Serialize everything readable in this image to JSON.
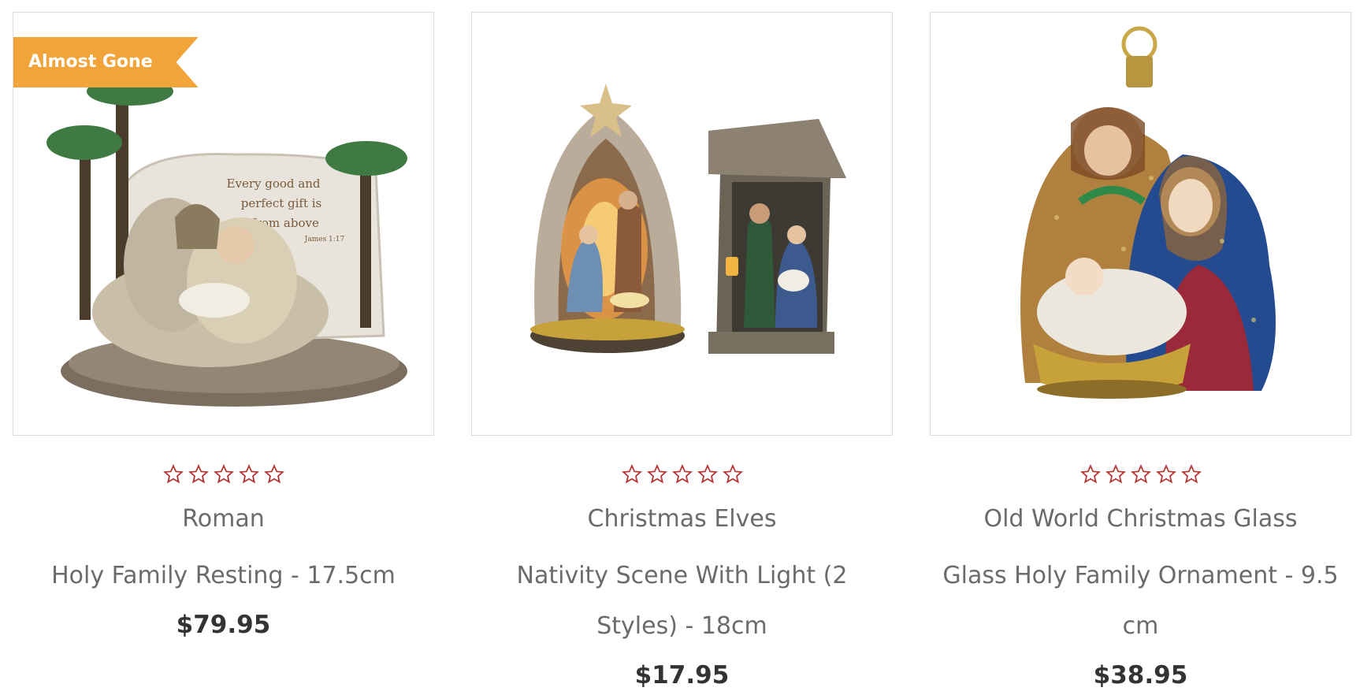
{
  "products": [
    {
      "badge": "Almost Gone",
      "brand": "Roman",
      "title": "Holy Family Resting - 17.5cm",
      "price": "$79.95",
      "rating_stars": 0,
      "image_caption_lines": [
        "Every good and",
        "perfect gift is",
        "from above"
      ],
      "image_caption_ref": "James 1:17"
    },
    {
      "brand": "Christmas Elves",
      "title": "Nativity Scene With Light (2 Styles) - 18cm",
      "price": "$17.95",
      "rating_stars": 0
    },
    {
      "brand": "Old World Christmas Glass",
      "title": "Glass Holy Family Ornament - 9.5 cm",
      "price": "$38.95",
      "rating_stars": 0
    }
  ],
  "colors": {
    "badge": "#f0a43a",
    "star_outline": "#b83232",
    "price": "#333333",
    "text": "#6b6b6b",
    "border": "#dcdcdc"
  },
  "icons": {
    "star": "star-outline-icon"
  }
}
